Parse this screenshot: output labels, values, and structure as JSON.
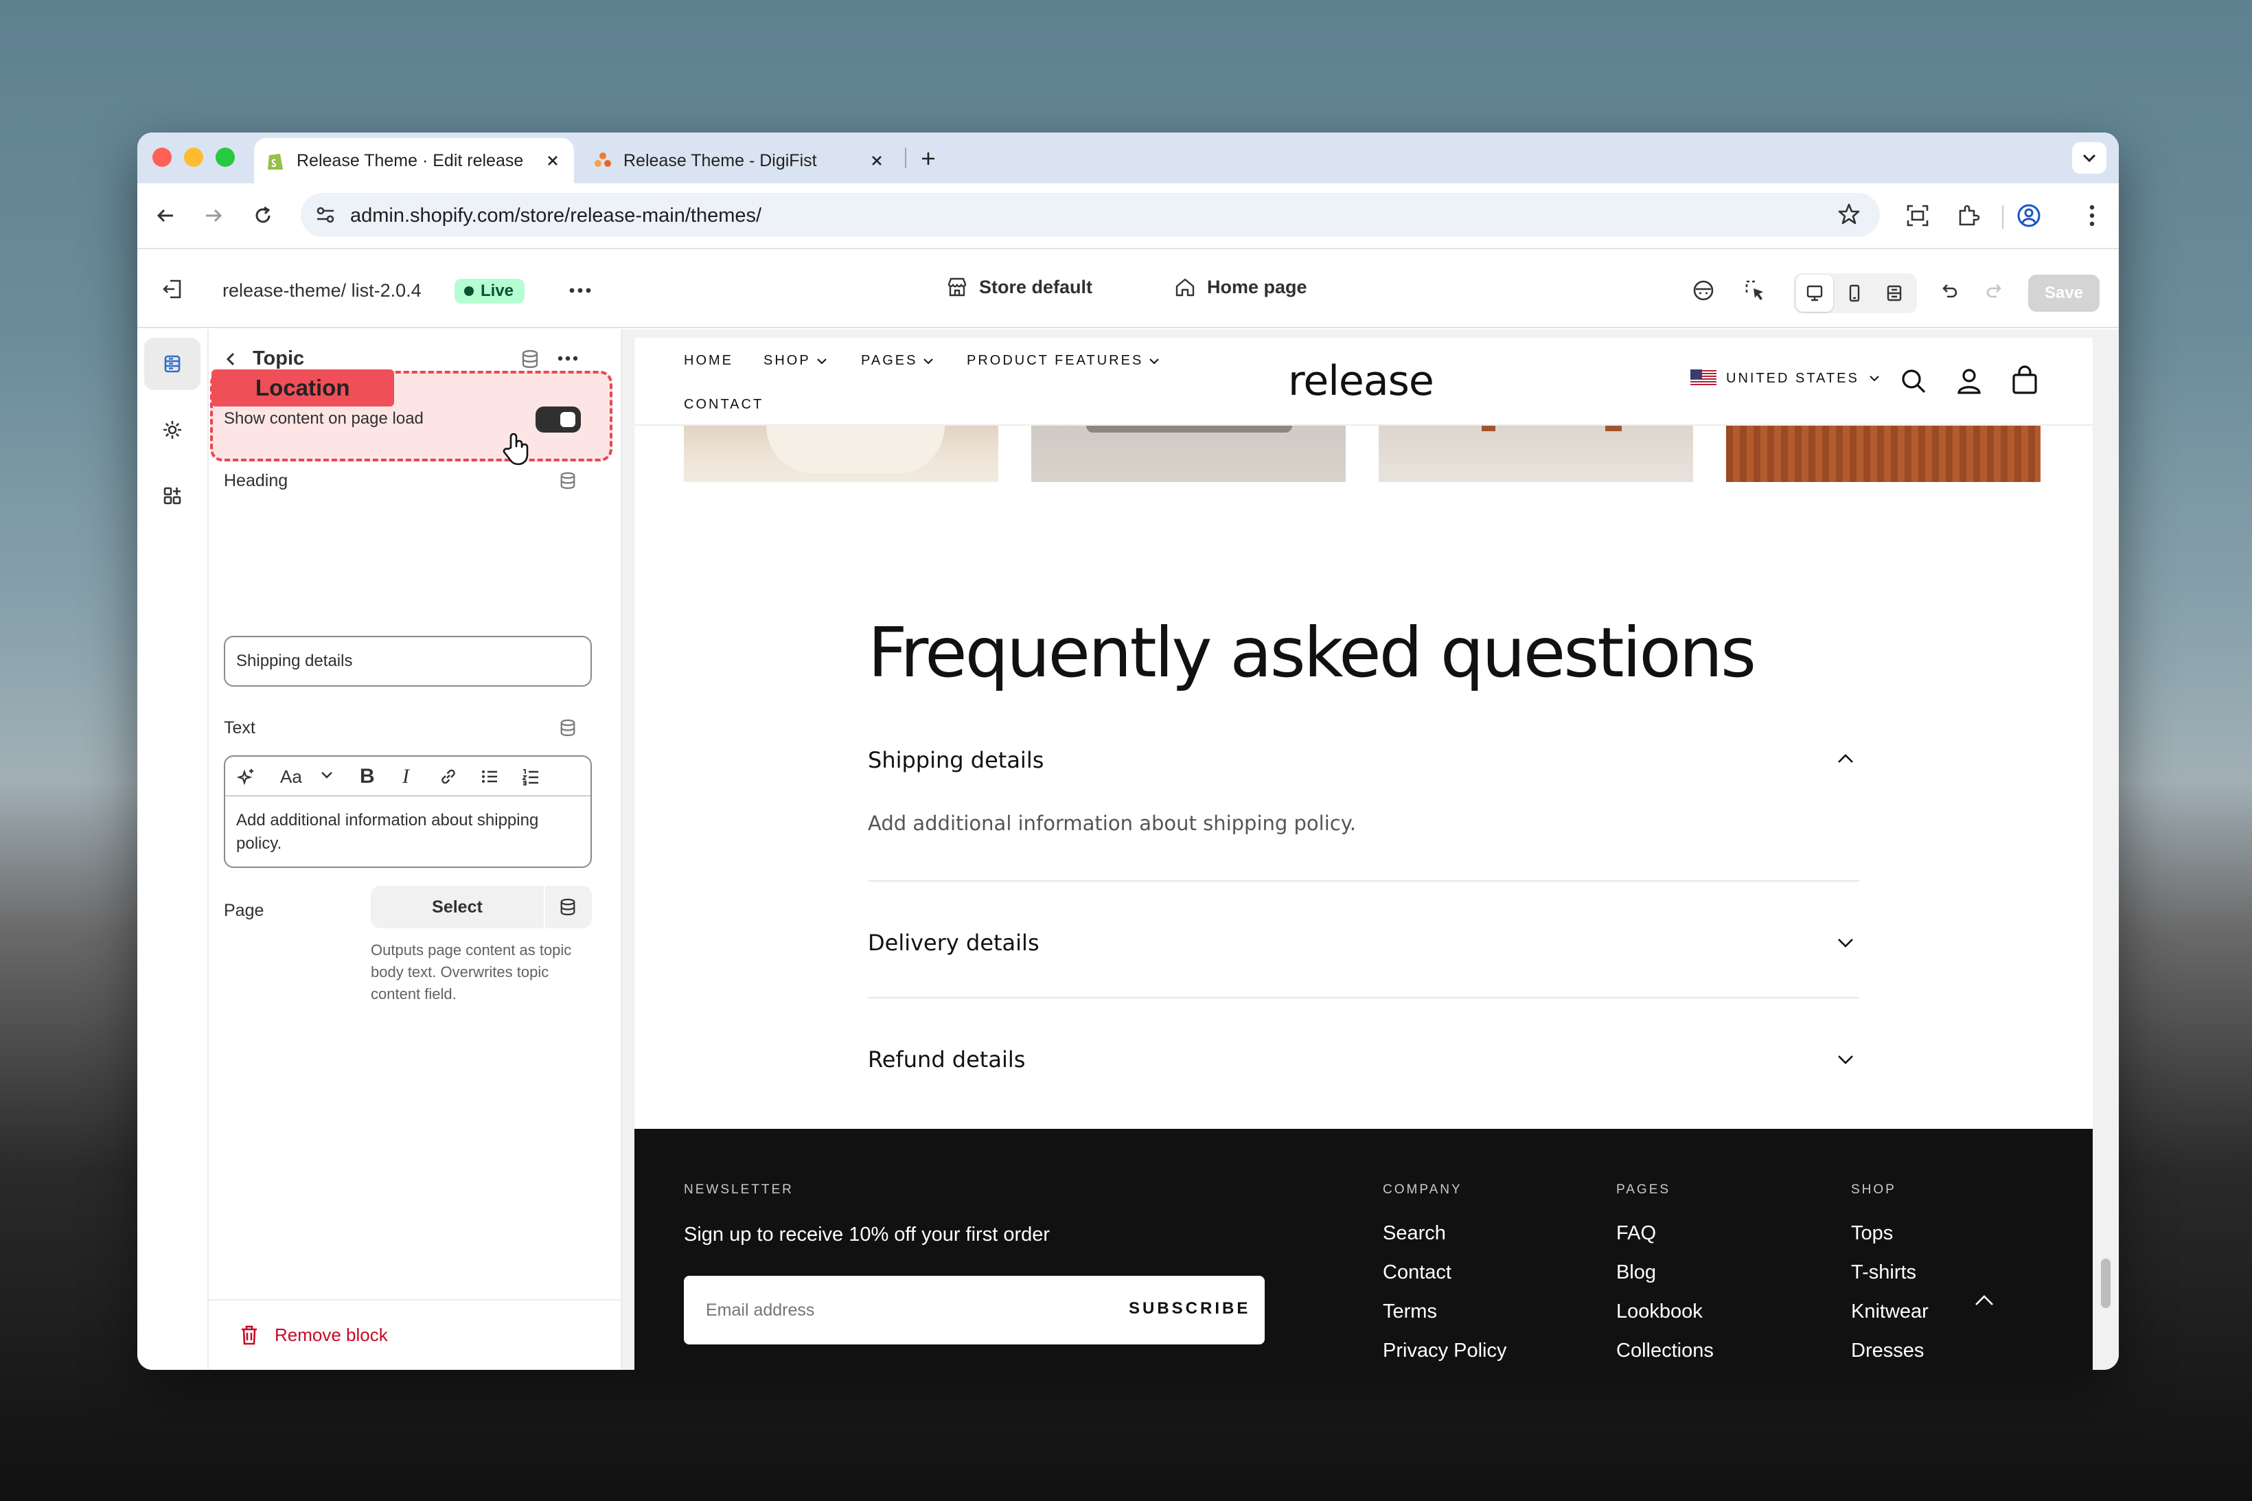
{
  "browser": {
    "tabs": [
      {
        "title": "Release Theme · Edit release · Shopify",
        "active": true
      },
      {
        "title": "Release Theme - DigiFist",
        "active": false
      }
    ],
    "url": "admin.shopify.com/store/release-main/themes/"
  },
  "topbar": {
    "theme_name": "release-theme/ list-2.0.4",
    "live_label": "Live",
    "store_label": "Store default",
    "page_label": "Home page",
    "save_label": "Save"
  },
  "panel": {
    "back_title": "Topic",
    "location_tag": "Location",
    "toggle_label": "Show content on page load",
    "toggle_on": true,
    "heading_label": "Heading",
    "heading_value": "Shipping details",
    "text_label": "Text",
    "text_value": "Add additional information about shipping policy.",
    "page_label": "Page",
    "select_label": "Select",
    "page_help": "Outputs page content as topic body text. Overwrites topic content field.",
    "remove_label": "Remove block"
  },
  "site": {
    "nav": {
      "home": "HOME",
      "shop": "SHOP",
      "pages": "PAGES",
      "features": "PRODUCT FEATURES",
      "contact": "CONTACT"
    },
    "logo": "release",
    "country": "UNITED STATES",
    "faq_heading": "Frequently asked questions",
    "faq": [
      {
        "q": "Shipping details",
        "a": "Add additional information about shipping policy.",
        "open": true
      },
      {
        "q": "Delivery details",
        "open": false
      },
      {
        "q": "Refund details",
        "open": false
      }
    ],
    "footer": {
      "newsletter_heading": "NEWSLETTER",
      "newsletter_text": "Sign up to receive 10% off your first order",
      "email_placeholder": "Email address",
      "subscribe": "SUBSCRIBE",
      "company": {
        "heading": "COMPANY",
        "links": [
          "Search",
          "Contact",
          "Terms",
          "Privacy Policy"
        ]
      },
      "pages": {
        "heading": "PAGES",
        "links": [
          "FAQ",
          "Blog",
          "Lookbook",
          "Collections"
        ]
      },
      "shop": {
        "heading": "SHOP",
        "links": [
          "Tops",
          "T-shirts",
          "Knitwear",
          "Dresses"
        ]
      }
    }
  },
  "colors": {
    "accent_red": "#e8474f",
    "live_green": "#b4fed2",
    "footer_bg": "#111111"
  }
}
